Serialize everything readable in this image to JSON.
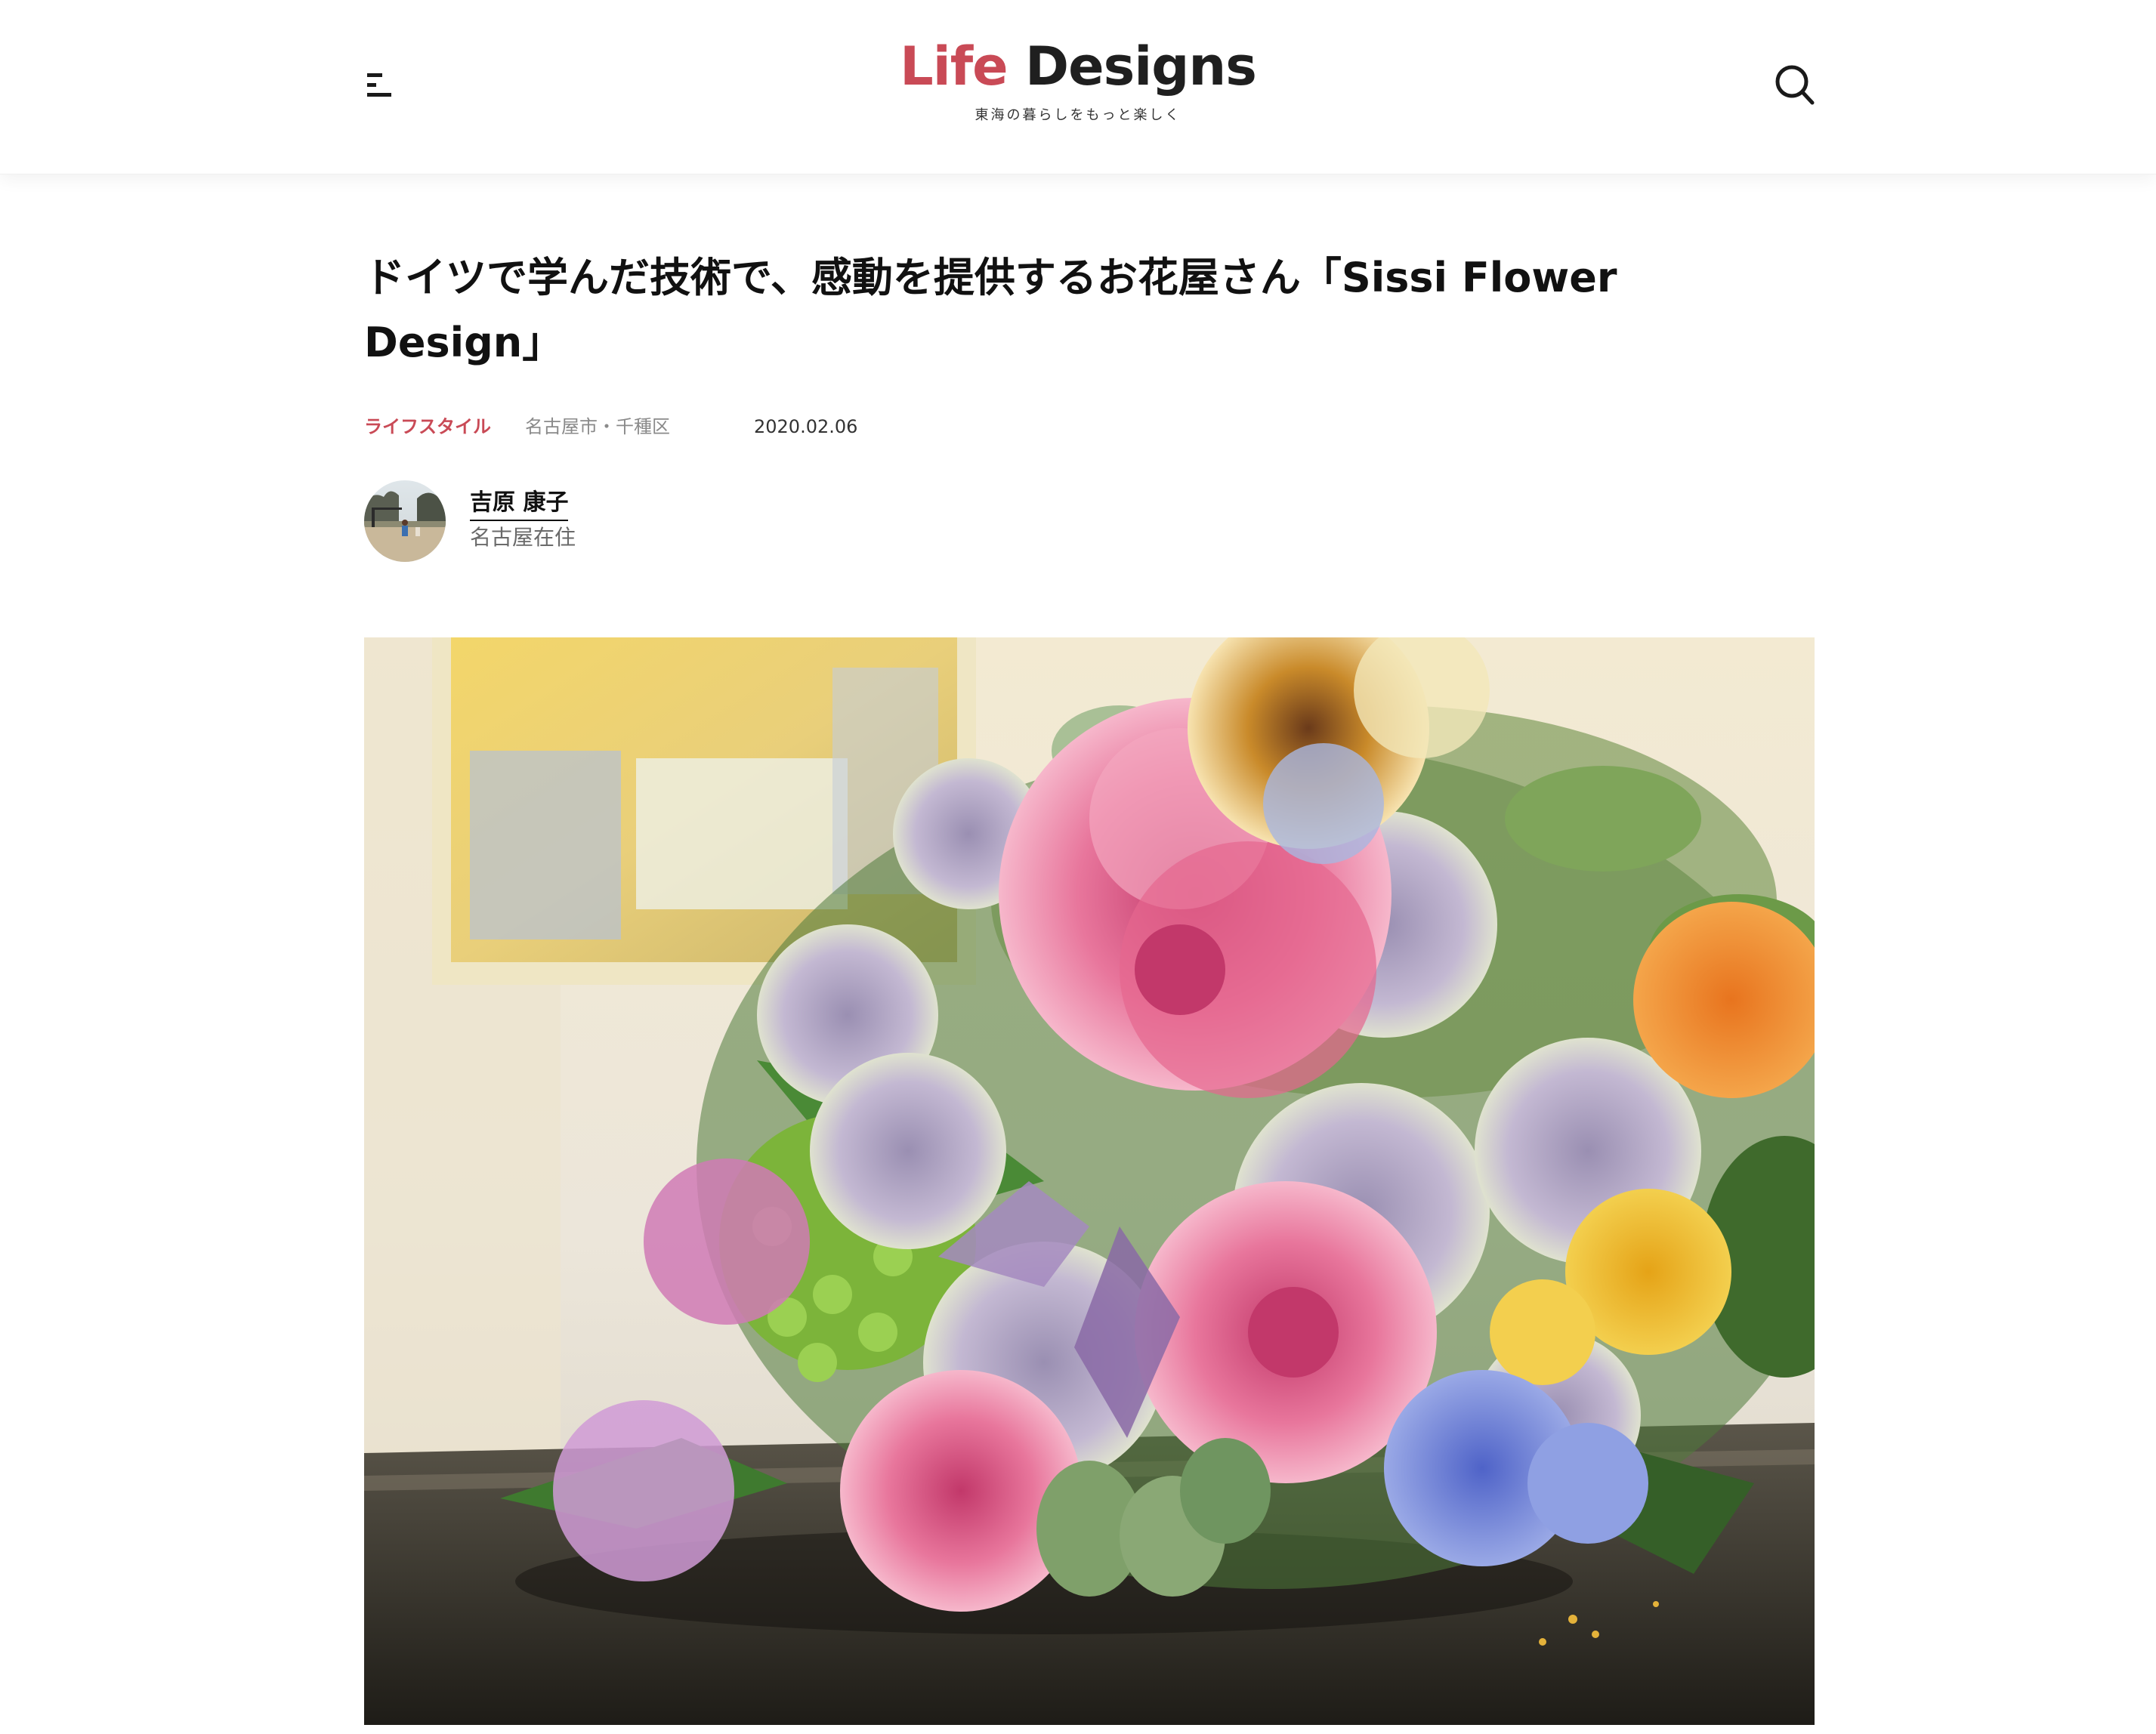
{
  "header": {
    "logo_word_1": "Life",
    "logo_word_2": "Designs",
    "tagline": "東海の暮らしをもっと楽しく",
    "menu_icon": "menu-icon",
    "search_icon": "search-icon"
  },
  "article": {
    "title": "ドイツで学んだ技術で、感動を提供するお花屋さん「Sissi Flower Design」",
    "category": "ライフスタイル",
    "location": "名古屋市・千種区",
    "date": "2020.02.06"
  },
  "author": {
    "name": "吉原 康子",
    "residence": "名古屋在住"
  },
  "colors": {
    "brand": "#c94a56",
    "text": "#1a1a1a",
    "muted": "#8a8a8a"
  }
}
